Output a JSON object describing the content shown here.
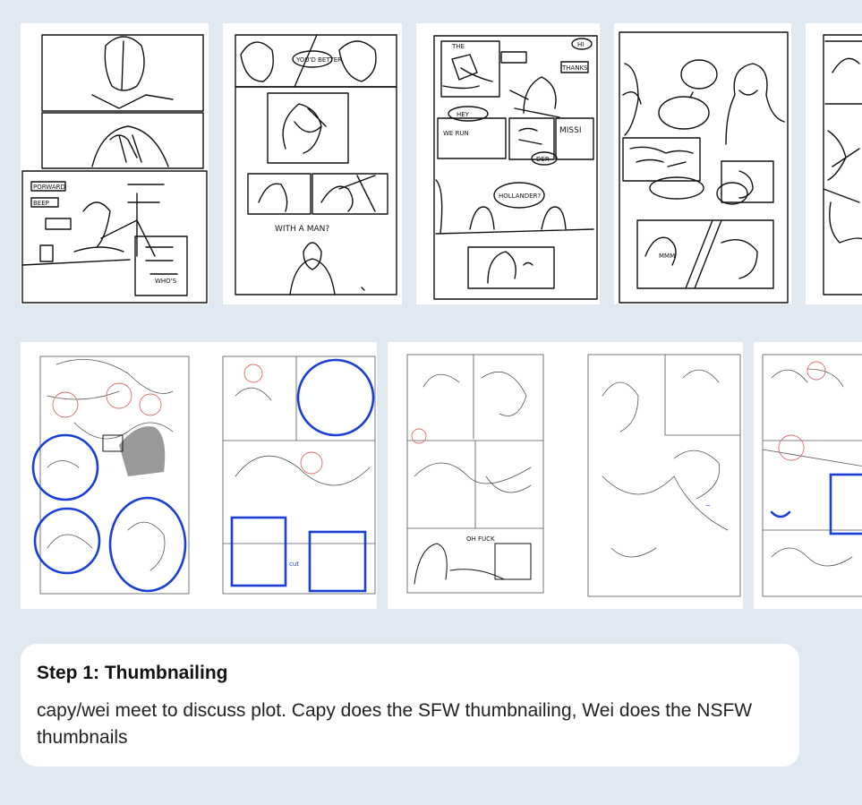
{
  "thumbnails_row1": [
    {
      "name": "sfw-thumbnail-page-1",
      "captions": [
        "PORWARD",
        "BEEP",
        "WHO'S"
      ]
    },
    {
      "name": "sfw-thumbnail-page-2",
      "captions": [
        "WITH A MAN?",
        "YOU'D BETTER"
      ]
    },
    {
      "name": "sfw-thumbnail-page-3",
      "captions": [
        "HI",
        "THE",
        "HEY",
        "WE RUN",
        "MISSI",
        "DER",
        "HOLLANDER?",
        "THANKS"
      ]
    },
    {
      "name": "sfw-thumbnail-page-4",
      "captions": [
        "MMM"
      ]
    },
    {
      "name": "sfw-thumbnail-page-5",
      "captions": []
    }
  ],
  "thumbnails_row2": [
    {
      "name": "nsfw-thumbnail-spread-1",
      "captions": []
    },
    {
      "name": "nsfw-thumbnail-spread-2",
      "captions": [
        "OH FUCK"
      ]
    },
    {
      "name": "nsfw-thumbnail-spread-3",
      "captions": []
    }
  ],
  "step": {
    "title": "Step 1: Thumbnailing",
    "description": "capy/wei meet to discuss plot. Capy does the SFW thumbnailing, Wei does the NSFW thumbnails"
  },
  "colors": {
    "background": "#e0e8f2",
    "card": "#ffffff",
    "annotation_blue": "#1a3fd6",
    "annotation_red": "#e06a6a"
  }
}
